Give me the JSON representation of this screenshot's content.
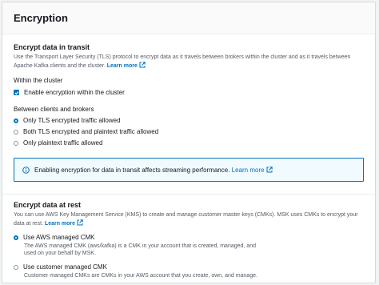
{
  "panel": {
    "title": "Encryption"
  },
  "transit": {
    "heading": "Encrypt data in transit",
    "description": "Use the Transport Layer Security (TLS) protocol to encrypt data as it travels between brokers within the cluster and as it travels between Apache Kafka clients and the cluster.",
    "learn_more": "Learn more"
  },
  "within_cluster": {
    "label": "Within the cluster",
    "checkbox_label": "Enable encryption within the cluster",
    "checked": true
  },
  "clients_brokers": {
    "label": "Between clients and brokers",
    "options": [
      {
        "label": "Only TLS encrypted traffic allowed",
        "selected": true
      },
      {
        "label": "Both TLS encrypted and plaintext traffic allowed",
        "selected": false
      },
      {
        "label": "Only plaintext traffic allowed",
        "selected": false
      }
    ]
  },
  "info": {
    "text": "Enabling encryption for data in transit affects streaming performance.",
    "learn_more": "Learn more"
  },
  "rest": {
    "heading": "Encrypt data at rest",
    "description": "You can use AWS Key Management Service (KMS) to create and manage customer master keys (CMKs). MSK uses CMKs to encrypt your data at rest.",
    "learn_more": "Learn more",
    "options": [
      {
        "label": "Use AWS managed CMK",
        "description": "The AWS managed CMK (aws/kafka) is a CMK in your account that is created, managed, and used on your behalf by MSK.",
        "selected": true
      },
      {
        "label": "Use customer managed CMK",
        "description": "Customer managed CMKs are CMKs in your AWS account that you create, own, and manage.",
        "selected": false
      }
    ]
  },
  "colors": {
    "accent": "#0073bb",
    "text": "#16191f",
    "muted": "#545b64"
  },
  "icons": {
    "external": "external-link-icon",
    "info": "info-icon",
    "check": "check-icon"
  }
}
